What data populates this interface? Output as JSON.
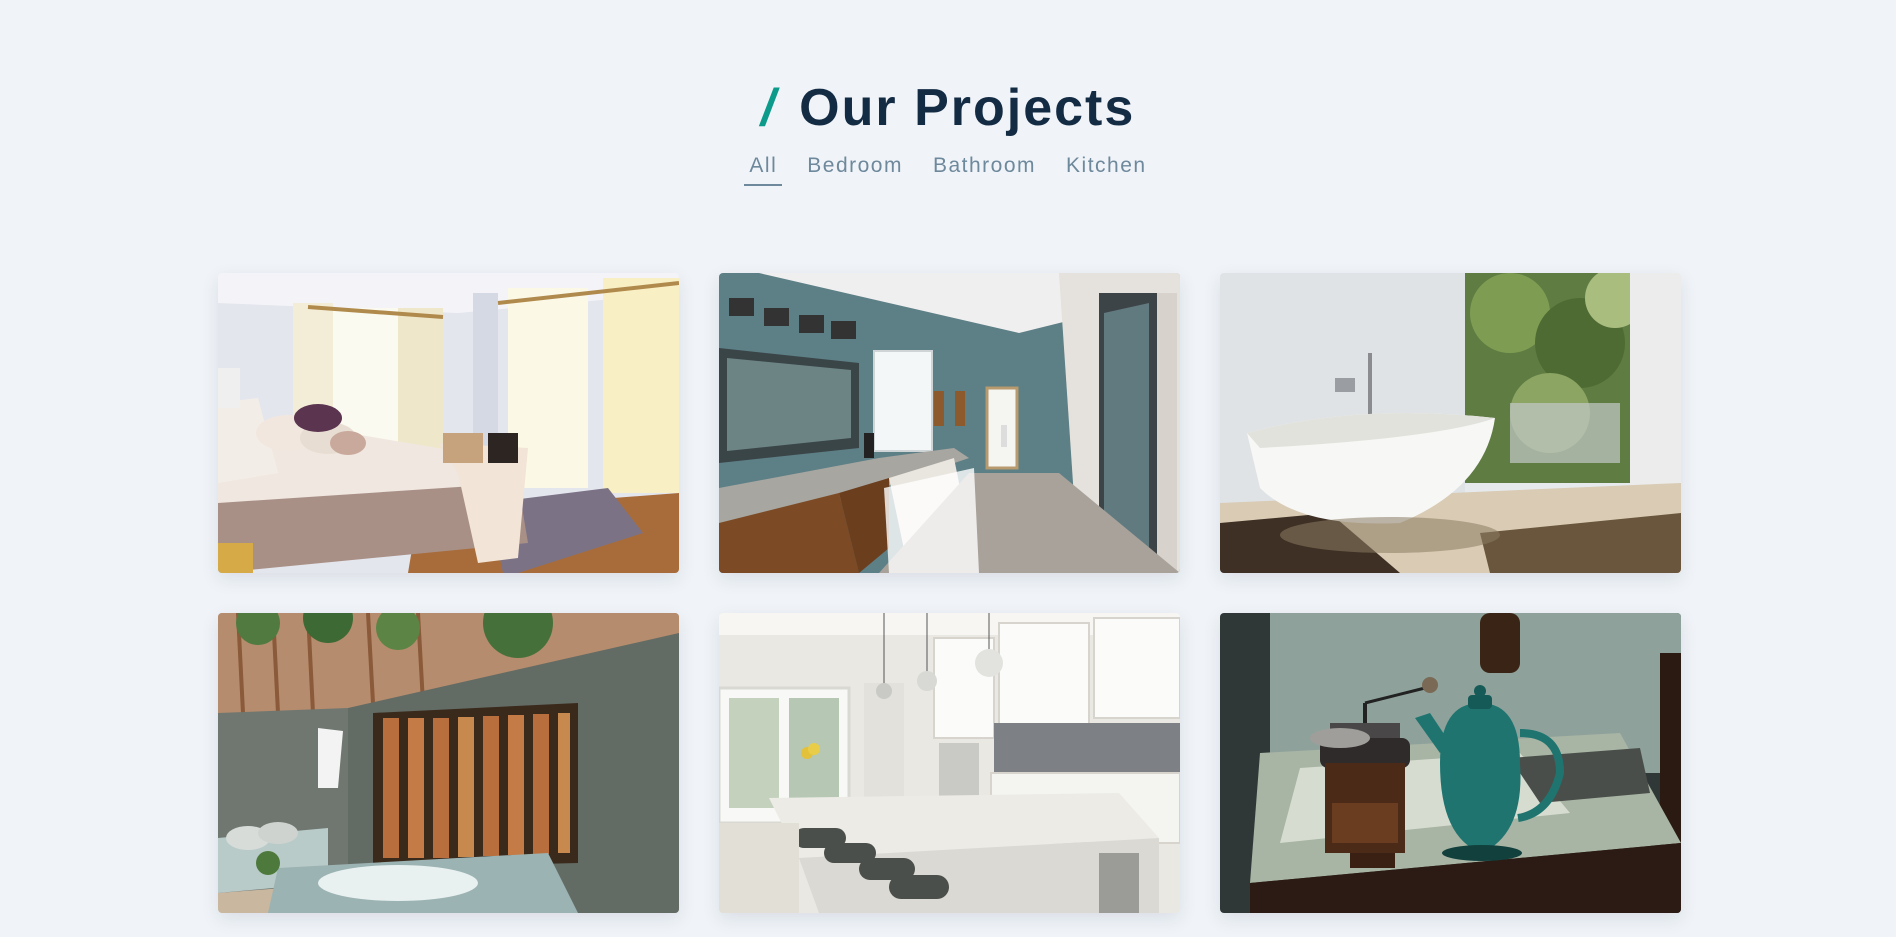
{
  "header": {
    "slash": "/",
    "title": "Our Projects"
  },
  "filters": [
    {
      "label": "All",
      "active": true
    },
    {
      "label": "Bedroom",
      "active": false
    },
    {
      "label": "Bathroom",
      "active": false
    },
    {
      "label": "Kitchen",
      "active": false
    }
  ],
  "projects": [
    {
      "category": "Bedroom"
    },
    {
      "category": "Bathroom"
    },
    {
      "category": "Bathroom"
    },
    {
      "category": "Bathroom"
    },
    {
      "category": "Kitchen"
    },
    {
      "category": "Kitchen"
    }
  ],
  "colors": {
    "background": "#f0f4f8",
    "accent": "#0c9b8a",
    "title": "#142b44",
    "filter_text": "#6e889c"
  }
}
